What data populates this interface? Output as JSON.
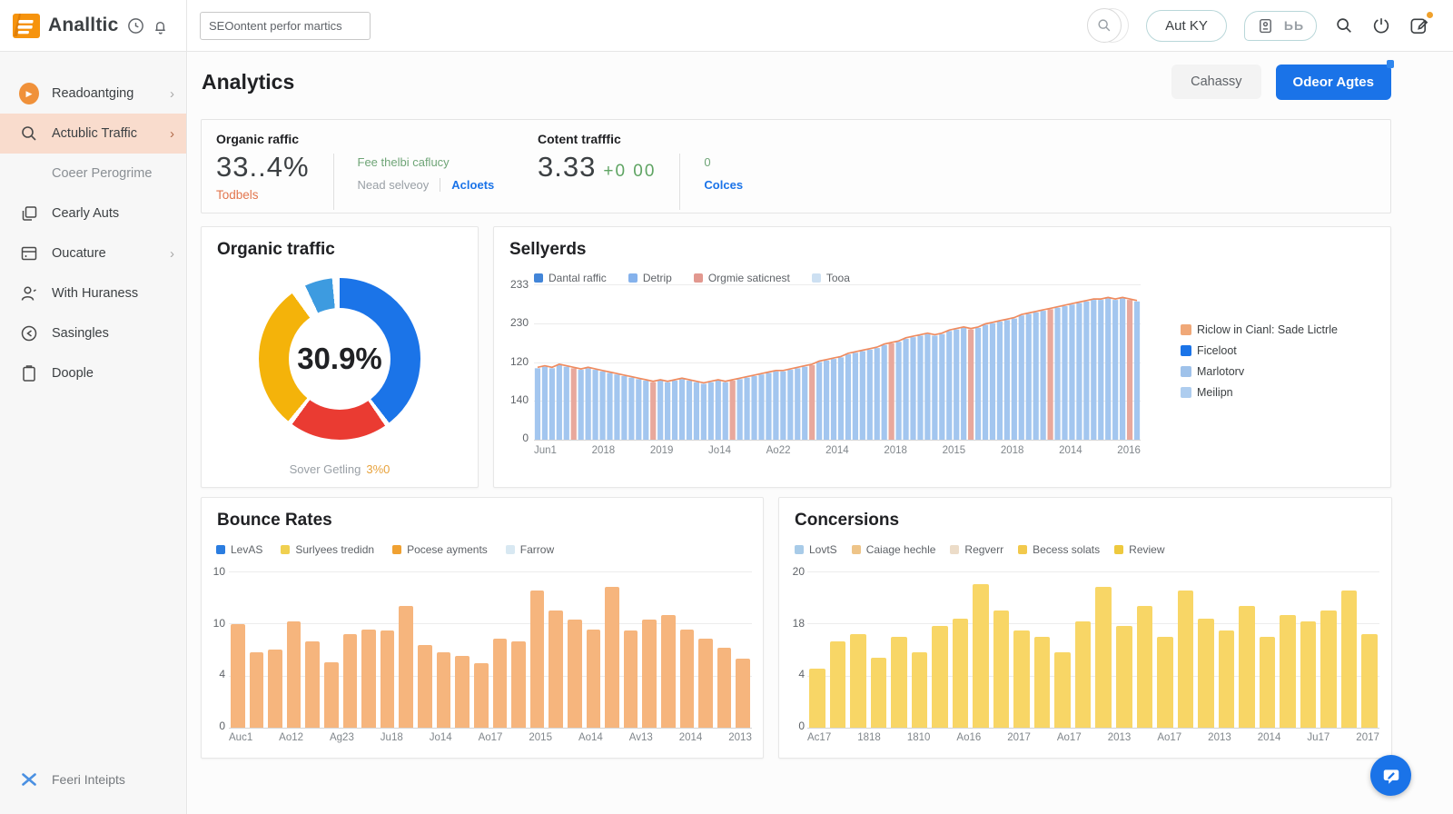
{
  "topbar": {
    "brand": "Analltic",
    "search_value": "SEOontent perfor martics",
    "user_button": "Aut KY",
    "bb_glyph": "ЬЬ"
  },
  "sidebar": {
    "items": [
      {
        "label": "Readoantging",
        "icon": "play-circle-icon",
        "chevron": true,
        "active": false
      },
      {
        "label": "Actublic Traffic",
        "icon": "search-icon",
        "chevron": true,
        "active": true
      },
      {
        "label": "Coeer Perogrime",
        "icon": null,
        "chevron": false,
        "active": false
      },
      {
        "label": "Cearly Auts",
        "icon": "copy-icon",
        "chevron": false,
        "active": false
      },
      {
        "label": "Oucature",
        "icon": "window-icon",
        "chevron": true,
        "active": false
      },
      {
        "label": "With Huraness",
        "icon": "user-icon",
        "chevron": false,
        "active": false
      },
      {
        "label": "Sasingles",
        "icon": "share-icon",
        "chevron": false,
        "active": false
      },
      {
        "label": "Doople",
        "icon": "clipboard-icon",
        "chevron": false,
        "active": false
      }
    ],
    "footer_item": {
      "label": "Feeri Inteipts",
      "icon": "x-icon"
    }
  },
  "header": {
    "title": "Analytics",
    "secondary_button": "Cahassy",
    "primary_button": "Odeor Agtes"
  },
  "stats": [
    {
      "title": "Organic raffic",
      "value": "33..4%",
      "sub": "Todbels",
      "line1": "Fee thelbi caflucy",
      "line2": "Nead selveoy",
      "link": "Acloets"
    },
    {
      "title": "Cotent trafffic",
      "value": "3.33",
      "delta": "+0 00",
      "line1": "0",
      "link": "Colces"
    }
  ],
  "chart_data": [
    {
      "type": "pie",
      "title": "Organic traffic",
      "center_label": "30.9%",
      "caption": "Sover Getling",
      "caption_value": "3%0",
      "slices": [
        {
          "label": "blue",
          "value": 39.5,
          "gap": 1,
          "color": "#1b74e8"
        },
        {
          "label": "red",
          "value": 19.5,
          "gap": 1,
          "color": "#ea3b32"
        },
        {
          "label": "yellow",
          "value": 29,
          "gap": 3,
          "color": "#f4b30a"
        },
        {
          "label": "light-blue",
          "value": 5.5,
          "gap": 1.5,
          "color": "#3d9be0"
        }
      ]
    },
    {
      "type": "bar-line",
      "title": "Sellyerds",
      "legend": [
        {
          "label": "Dantal raffic",
          "color": "#4285d8"
        },
        {
          "label": "Detrip",
          "color": "#85b2ec"
        },
        {
          "label": "Orgmie saticnest",
          "color": "#e2988f"
        },
        {
          "label": "Tooa",
          "color": "#cde0f2"
        }
      ],
      "side_legend": [
        {
          "label": "Riclow in Cianl: Sade Lictrle",
          "color": "#f0a878"
        },
        {
          "label": "Ficeloot",
          "color": "#1b74e8"
        },
        {
          "label": "Marlotorv",
          "color": "#9fc2ea"
        },
        {
          "label": "Meilipn",
          "color": "#aecdef"
        }
      ],
      "y_ticks": [
        "233",
        "230",
        "120",
        "140",
        "0"
      ],
      "x_labels": [
        "Jun1",
        "2018",
        "2019",
        "Jo14",
        "Ao22",
        "2014",
        "2018",
        "2015",
        "2018",
        "2014",
        "2016"
      ],
      "values": [
        46,
        47,
        46,
        48,
        47,
        46,
        45,
        46,
        45,
        44,
        43,
        42,
        41,
        40,
        39,
        38,
        37,
        38,
        37,
        38,
        39,
        38,
        37,
        36,
        37,
        38,
        37,
        38,
        39,
        40,
        41,
        42,
        43,
        44,
        44,
        45,
        46,
        47,
        48,
        50,
        51,
        52,
        53,
        55,
        56,
        57,
        58,
        59,
        61,
        62,
        63,
        65,
        66,
        67,
        68,
        67,
        68,
        70,
        71,
        72,
        71,
        72,
        74,
        75,
        76,
        77,
        78,
        80,
        81,
        82,
        83,
        84,
        85,
        86,
        87,
        88,
        89,
        90,
        90,
        91,
        90,
        91,
        90,
        89
      ],
      "bar_color": "#a3c6ef",
      "accent_bar_color": "#e8a89c",
      "line_color": "#ef8b5f"
    },
    {
      "type": "bar",
      "title": "Bounce Rates",
      "legend": [
        {
          "label": "LevAS",
          "color": "#2b7de0"
        },
        {
          "label": "Surlyees tredidn",
          "color": "#f0d050"
        },
        {
          "label": "Pocese ayments",
          "color": "#f0a132"
        },
        {
          "label": "Farrow",
          "color": "#d8e8f2"
        }
      ],
      "y_ticks": [
        "10",
        "10",
        "4",
        "0"
      ],
      "x_labels": [
        "Auc1",
        "Ao12",
        "Ag23",
        "Ju18",
        "Jo14",
        "Ao17",
        "2015",
        "Ao14",
        "Av13",
        "2014",
        "2013"
      ],
      "values": [
        66,
        48,
        50,
        68,
        55,
        42,
        60,
        63,
        62,
        78,
        53,
        48,
        46,
        41,
        57,
        55,
        88,
        75,
        69,
        63,
        90,
        62,
        69,
        72,
        63,
        57,
        51,
        44
      ],
      "bar_color": "#f6b57d"
    },
    {
      "type": "bar",
      "title": "Concersions",
      "legend": [
        {
          "label": "LovtS",
          "color": "#a8cbe8"
        },
        {
          "label": "Caiage hechle",
          "color": "#eec488"
        },
        {
          "label": "Regverr",
          "color": "#ecdcc8"
        },
        {
          "label": "Becess solats",
          "color": "#f2c94c"
        },
        {
          "label": "Review",
          "color": "#eec93e"
        }
      ],
      "y_ticks": [
        "20",
        "18",
        "4",
        "0"
      ],
      "x_labels": [
        "Ac17",
        "1818",
        "1810",
        "Ao16",
        "2017",
        "Ao17",
        "2013",
        "Ao17",
        "2013",
        "2014",
        "Ju17",
        "2017"
      ],
      "values": [
        38,
        55,
        60,
        45,
        58,
        48,
        65,
        70,
        92,
        75,
        62,
        58,
        48,
        68,
        90,
        65,
        78,
        58,
        88,
        70,
        62,
        78,
        58,
        72,
        68,
        75,
        88,
        60
      ],
      "bar_color": "#f8d666"
    }
  ],
  "colors": {
    "accent_blue": "#1a73e8",
    "logo_orange": "#f6930d",
    "sidebar_active_bg": "#f9dccd",
    "orange_text": "#e2764e",
    "green_text": "#5fa463"
  }
}
